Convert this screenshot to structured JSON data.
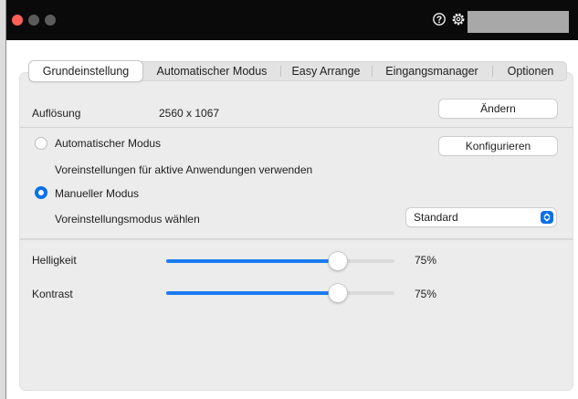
{
  "tabs": [
    {
      "label": "Grundeinstellung",
      "active": true
    },
    {
      "label": "Automatischer Modus",
      "active": false
    },
    {
      "label": "Easy Arrange",
      "active": false
    },
    {
      "label": "Eingangsmanager",
      "active": false
    },
    {
      "label": "Optionen",
      "active": false
    }
  ],
  "resolution": {
    "label": "Auflösung",
    "value": "2560 x 1067",
    "change_button": "Ändern"
  },
  "auto_mode": {
    "label": "Automatischer Modus",
    "selected": false,
    "configure_button": "Konfigurieren",
    "description": "Voreinstellungen für aktive Anwendungen verwenden"
  },
  "manual_mode": {
    "label": "Manueller Modus",
    "selected": true,
    "preset_label": "Voreinstellungsmodus wählen",
    "preset_value": "Standard"
  },
  "brightness": {
    "label": "Helligkeit",
    "value": 0.75,
    "display": "75%"
  },
  "contrast": {
    "label": "Kontrast",
    "value": 0.75,
    "display": "75%"
  },
  "colors": {
    "accent": "#0a70e8",
    "close": "#fe5f57"
  }
}
